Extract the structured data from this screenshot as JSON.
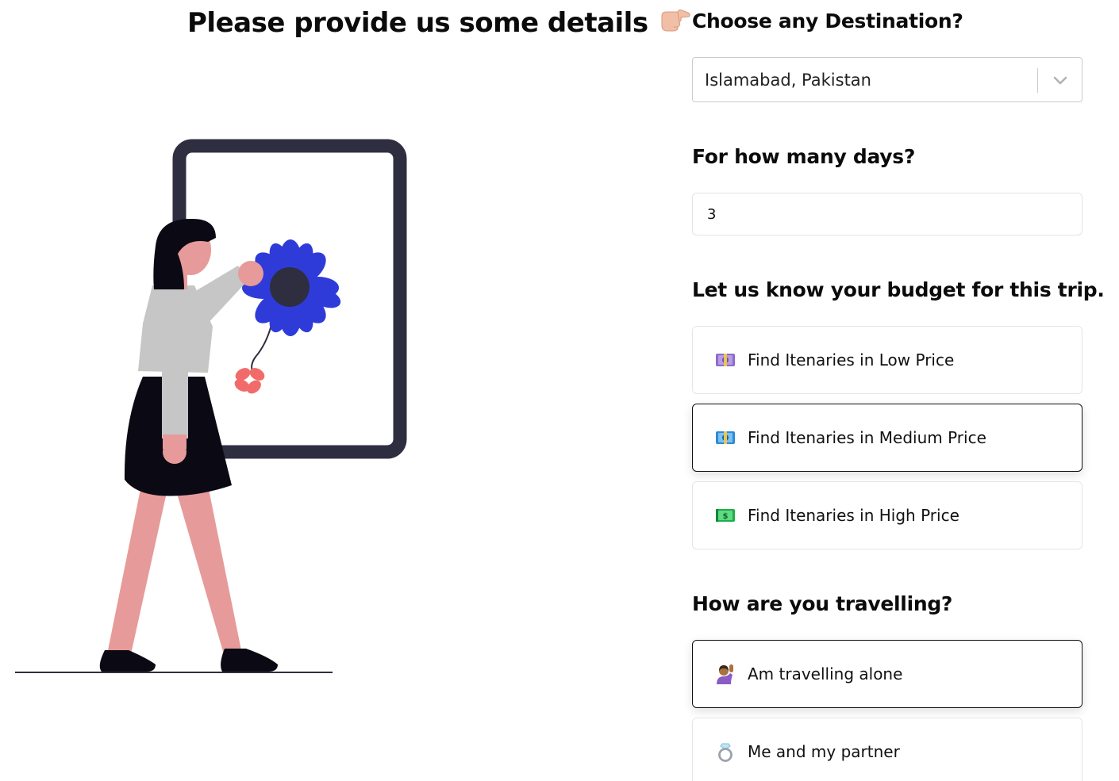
{
  "header": {
    "title": "Please provide us some details",
    "title_icon": "pointing-hand-icon"
  },
  "destination": {
    "label": "Choose any Destination?",
    "value": "Islamabad, Pakistan",
    "icon": "chevron-down-icon"
  },
  "days": {
    "label": "For how many days?",
    "value": "3"
  },
  "budget": {
    "label": "Let us know your budget for this trip.",
    "options": [
      {
        "label": "Find Itenaries in Low Price",
        "icon": "money-purple-icon",
        "selected": false
      },
      {
        "label": "Find Itenaries in Medium Price",
        "icon": "money-blue-icon",
        "selected": true
      },
      {
        "label": "Find Itenaries in High Price",
        "icon": "money-green-icon",
        "selected": false
      }
    ]
  },
  "travel": {
    "label": "How are you travelling?",
    "options": [
      {
        "label": "Am travelling alone",
        "icon": "person-raising-hand-icon",
        "selected": true
      },
      {
        "label": "Me and my partner",
        "icon": "ring-icon",
        "selected": false
      }
    ]
  },
  "colors": {
    "flower": "#2f3bd9",
    "flower_center": "#2f2e41",
    "frame": "#2f2e41",
    "skin": "#e79a9a",
    "shirt": "#c6c6c6",
    "skirt": "#0b0a14",
    "small_flower": "#f26b6b"
  }
}
